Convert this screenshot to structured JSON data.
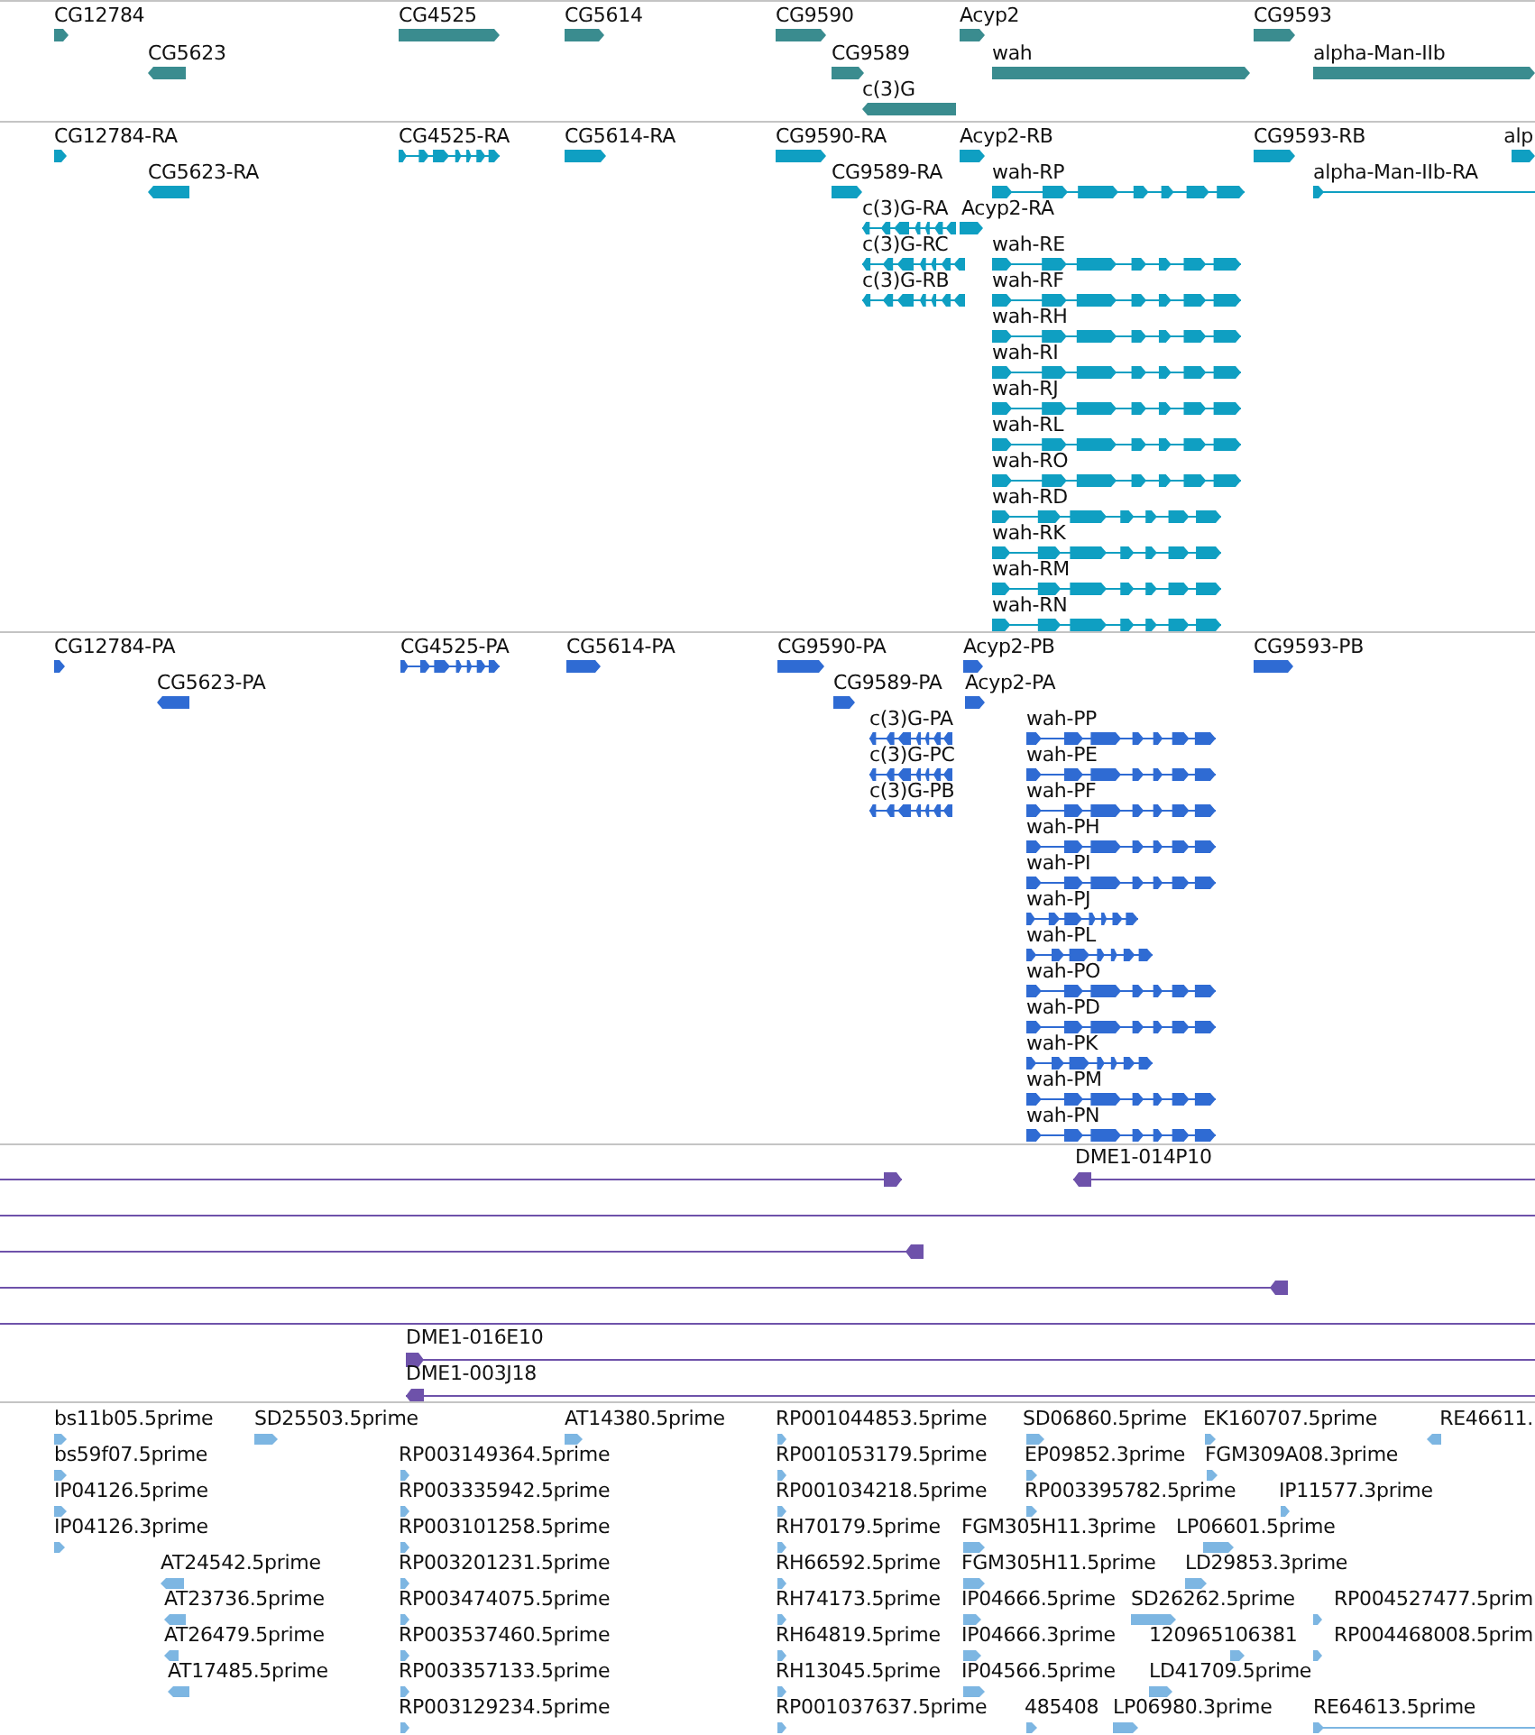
{
  "tracks": [
    {
      "kind": "gene",
      "features": [
        {
          "label": "CG12784",
          "reverse": false
        },
        {
          "label": "CG4525",
          "reverse": false
        },
        {
          "label": "CG5614",
          "reverse": false
        },
        {
          "label": "CG9590",
          "reverse": false
        },
        {
          "label": "Acyp2",
          "reverse": false
        },
        {
          "label": "CG9593",
          "reverse": false
        },
        {
          "label": "CG5623",
          "reverse": true
        },
        {
          "label": "CG9589",
          "reverse": false
        },
        {
          "label": "wah",
          "reverse": false
        },
        {
          "label": "alpha-Man-IIb",
          "reverse": false
        },
        {
          "label": "c(3)G",
          "reverse": true
        }
      ]
    },
    {
      "kind": "transcript",
      "features": [
        {
          "label": "CG12784-RA",
          "reverse": false
        },
        {
          "label": "CG4525-RA",
          "reverse": false
        },
        {
          "label": "CG5614-RA",
          "reverse": false
        },
        {
          "label": "CG9590-RA",
          "reverse": false
        },
        {
          "label": "Acyp2-RB",
          "reverse": false
        },
        {
          "label": "CG9593-RB",
          "reverse": false
        },
        {
          "label": "alp",
          "reverse": false
        },
        {
          "label": "CG5623-RA",
          "reverse": true
        },
        {
          "label": "CG9589-RA",
          "reverse": false
        },
        {
          "label": "wah-RP",
          "reverse": false
        },
        {
          "label": "alpha-Man-IIb-RA",
          "reverse": false
        },
        {
          "label": "c(3)G-RA",
          "reverse": true
        },
        {
          "label": "Acyp2-RA",
          "reverse": false
        },
        {
          "label": "c(3)G-RC",
          "reverse": true
        },
        {
          "label": "wah-RE",
          "reverse": false
        },
        {
          "label": "c(3)G-RB",
          "reverse": true
        },
        {
          "label": "wah-RF",
          "reverse": false
        },
        {
          "label": "wah-RH",
          "reverse": false
        },
        {
          "label": "wah-RI",
          "reverse": false
        },
        {
          "label": "wah-RJ",
          "reverse": false
        },
        {
          "label": "wah-RL",
          "reverse": false
        },
        {
          "label": "wah-RO",
          "reverse": false
        },
        {
          "label": "wah-RD",
          "reverse": false
        },
        {
          "label": "wah-RK",
          "reverse": false
        },
        {
          "label": "wah-RM",
          "reverse": false
        },
        {
          "label": "wah-RN",
          "reverse": false
        }
      ]
    },
    {
      "kind": "protein",
      "features": [
        {
          "label": "CG12784-PA",
          "reverse": false
        },
        {
          "label": "CG4525-PA",
          "reverse": false
        },
        {
          "label": "CG5614-PA",
          "reverse": false
        },
        {
          "label": "CG9590-PA",
          "reverse": false
        },
        {
          "label": "Acyp2-PB",
          "reverse": false
        },
        {
          "label": "CG9593-PB",
          "reverse": false
        },
        {
          "label": "CG5623-PA",
          "reverse": true
        },
        {
          "label": "CG9589-PA",
          "reverse": false
        },
        {
          "label": "Acyp2-PA",
          "reverse": false
        },
        {
          "label": "c(3)G-PA",
          "reverse": true
        },
        {
          "label": "wah-PP",
          "reverse": false
        },
        {
          "label": "c(3)G-PC",
          "reverse": true
        },
        {
          "label": "wah-PE",
          "reverse": false
        },
        {
          "label": "c(3)G-PB",
          "reverse": true
        },
        {
          "label": "wah-PF",
          "reverse": false
        },
        {
          "label": "wah-PH",
          "reverse": false
        },
        {
          "label": "wah-PI",
          "reverse": false
        },
        {
          "label": "wah-PJ",
          "reverse": false
        },
        {
          "label": "wah-PL",
          "reverse": false
        },
        {
          "label": "wah-PO",
          "reverse": false
        },
        {
          "label": "wah-PD",
          "reverse": false
        },
        {
          "label": "wah-PK",
          "reverse": false
        },
        {
          "label": "wah-PM",
          "reverse": false
        },
        {
          "label": "wah-PN",
          "reverse": false
        }
      ]
    },
    {
      "kind": "clone",
      "features": [
        {
          "reverse": false
        },
        {
          "label": "DME1-014P10",
          "reverse": true
        },
        {
          "kind": "span"
        },
        {
          "reverse": true
        },
        {
          "reverse": true
        },
        {
          "kind": "span"
        },
        {
          "label": "DME1-016E10",
          "reverse": false
        },
        {
          "label": "DME1-003J18",
          "reverse": true
        }
      ]
    },
    {
      "kind": "est",
      "features": [
        {
          "label": "bs11b05.5prime",
          "reverse": false
        },
        {
          "label": "SD25503.5prime",
          "reverse": false
        },
        {
          "label": "AT14380.5prime",
          "reverse": false
        },
        {
          "label": "RP001044853.5prime",
          "reverse": false
        },
        {
          "label": "SD06860.5prime",
          "reverse": false
        },
        {
          "label": "EK160707.5prime",
          "reverse": false
        },
        {
          "label": "RE46611.",
          "reverse": true
        },
        {
          "label": "bs59f07.5prime",
          "reverse": false
        },
        {
          "label": "RP003149364.5prime",
          "reverse": false
        },
        {
          "label": "RP001053179.5prime",
          "reverse": false
        },
        {
          "label": "EP09852.3prime",
          "reverse": false
        },
        {
          "label": "FGM309A08.3prime",
          "reverse": false
        },
        {
          "label": "IP04126.5prime",
          "reverse": false
        },
        {
          "label": "RP003335942.5prime",
          "reverse": false
        },
        {
          "label": "RP001034218.5prime",
          "reverse": false
        },
        {
          "label": "RP003395782.5prime",
          "reverse": false
        },
        {
          "label": "IP11577.3prime",
          "reverse": false
        },
        {
          "label": "IP04126.3prime",
          "reverse": false
        },
        {
          "label": "RP003101258.5prime",
          "reverse": false
        },
        {
          "label": "RH70179.5prime",
          "reverse": false
        },
        {
          "label": "FGM305H11.3prime",
          "reverse": false
        },
        {
          "label": "LP06601.5prime",
          "reverse": false
        },
        {
          "label": "AT24542.5prime",
          "reverse": true
        },
        {
          "label": "RP003201231.5prime",
          "reverse": false
        },
        {
          "label": "RH66592.5prime",
          "reverse": false
        },
        {
          "label": "FGM305H11.5prime",
          "reverse": false
        },
        {
          "label": "LD29853.3prime",
          "reverse": false
        },
        {
          "label": "AT23736.5prime",
          "reverse": true
        },
        {
          "label": "RP003474075.5prime",
          "reverse": false
        },
        {
          "label": "RH74173.5prime",
          "reverse": false
        },
        {
          "label": "IP04666.5prime",
          "reverse": false
        },
        {
          "label": "SD26262.5prime",
          "reverse": false
        },
        {
          "label": "RP004527477.5prim",
          "reverse": false
        },
        {
          "label": "AT26479.5prime",
          "reverse": true
        },
        {
          "label": "RP003537460.5prime",
          "reverse": false
        },
        {
          "label": "RH64819.5prime",
          "reverse": false
        },
        {
          "label": "IP04666.3prime",
          "reverse": false
        },
        {
          "label": "120965106381",
          "reverse": false
        },
        {
          "label": "RP004468008.5prim",
          "reverse": false
        },
        {
          "label": "AT17485.5prime",
          "reverse": true
        },
        {
          "label": "RP003357133.5prime",
          "reverse": false
        },
        {
          "label": "RH13045.5prime",
          "reverse": false
        },
        {
          "label": "IP04566.5prime",
          "reverse": false
        },
        {
          "label": "LD41709.5prime",
          "reverse": false
        },
        {
          "label": "RP003129234.5prime",
          "reverse": false
        },
        {
          "label": "RP001037637.5prime",
          "reverse": false
        },
        {
          "label": "485408",
          "reverse": false
        },
        {
          "label": "LP06980.3prime",
          "reverse": false
        },
        {
          "label": "RE64613.5prime",
          "reverse": false
        }
      ]
    }
  ]
}
